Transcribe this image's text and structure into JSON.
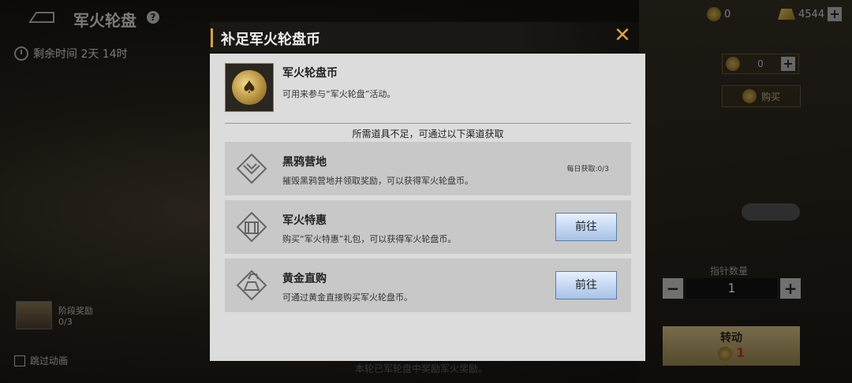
{
  "page": {
    "title": "军火轮盘",
    "timer": "剩余时间 2天 14时"
  },
  "currency": {
    "coin_count": "0",
    "gold_count": "4544"
  },
  "right_panel": {
    "coin_qty": "0",
    "buy_label": "购买",
    "pointer_label": "指针数量",
    "pointer_value": "1",
    "spin_label": "转动",
    "spin_cost": "1"
  },
  "left_panel": {
    "stage_reward_label": "阶段奖励",
    "stage_reward_progress": "0/3",
    "skip_animation": "跳过动画"
  },
  "bottom_hint": "本轮已军轮盘中奖励军火奖励。",
  "modal": {
    "title": "补足军火轮盘币",
    "item_name": "军火轮盘币",
    "item_desc": "可用来参与“军火轮盘”活动。",
    "insufficient_text": "所需道具不足，可通过以下渠道获取",
    "sources": [
      {
        "name": "黑鸦营地",
        "desc": "摧毁黑鸦营地并领取奖励，可以获得军火轮盘币。",
        "daily": "每日获取:0/3",
        "icon": "crow-emblem-icon"
      },
      {
        "name": "军火特惠",
        "desc": "购买“军火特惠”礼包，可以获得军火轮盘币。",
        "button": "前往",
        "icon": "gift-pack-icon"
      },
      {
        "name": "黄金直购",
        "desc": "可通过黄金直接购买军火轮盘币。",
        "button": "前往",
        "icon": "gold-bars-icon"
      }
    ]
  },
  "colors": {
    "accent": "#d8a04a",
    "modal_bg": "#dcdcdc",
    "source_bg": "#c8c8c8",
    "button_blue": "#a8c2e6"
  }
}
